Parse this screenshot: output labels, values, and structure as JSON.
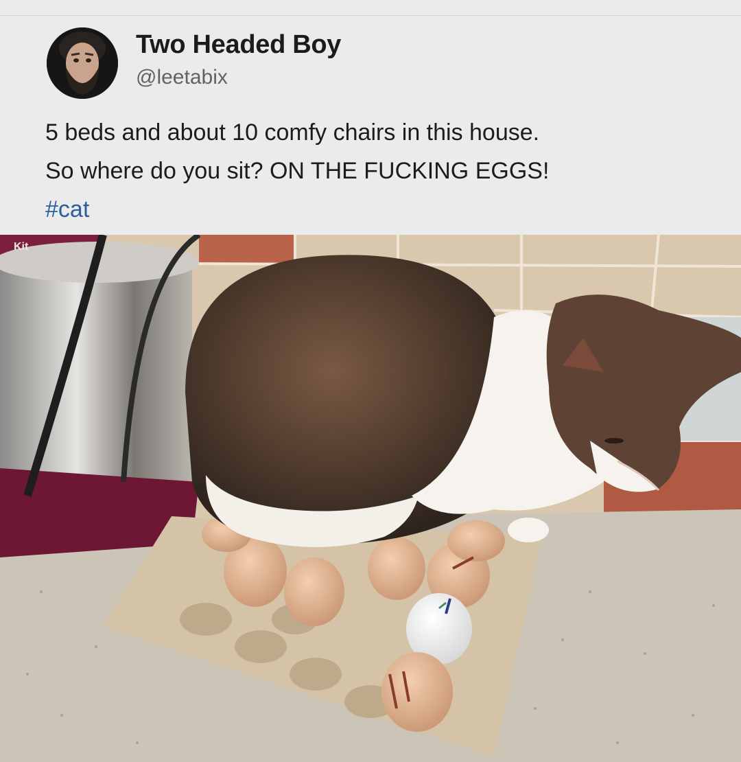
{
  "post": {
    "author_name": "Two Headed Boy",
    "author_handle": "@leetabix",
    "text_line1": "5 beds and about 10 comfy chairs in this house.",
    "text_line2": "So where do you sit? ON THE FUCKING EGGS!",
    "hashtag": "#cat"
  },
  "photo": {
    "subject": "cat sitting on egg carton",
    "icon": "photo-icon",
    "mixer_label": "Kit"
  },
  "colors": {
    "background": "#ebebeb",
    "name": "#1b1b1b",
    "handle": "#5f6368",
    "hashtag": "#2b5f9e"
  }
}
